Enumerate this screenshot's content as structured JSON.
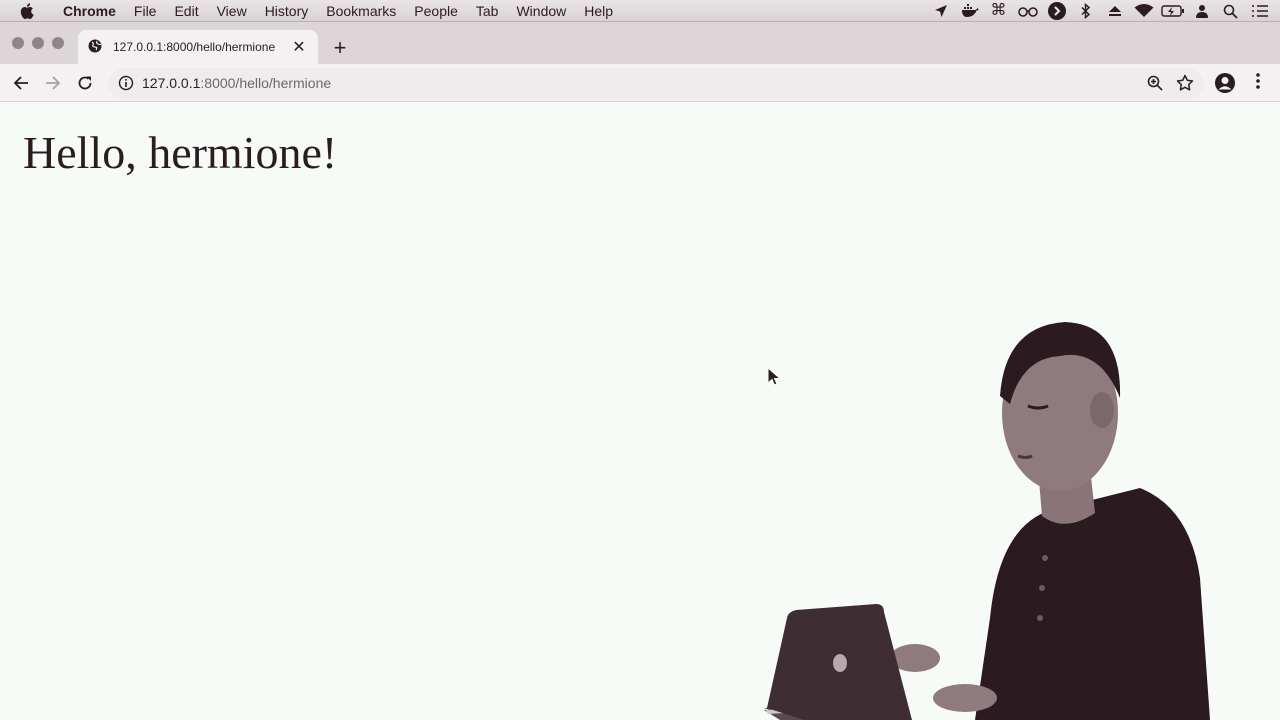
{
  "menubar": {
    "app": "Chrome",
    "items": [
      "File",
      "Edit",
      "View",
      "History",
      "Bookmarks",
      "People",
      "Tab",
      "Window",
      "Help"
    ],
    "status_icons": [
      "location-arrow-icon",
      "docker-icon",
      "command-icon",
      "glasses-icon",
      "chevron-circle-icon",
      "bluetooth-icon",
      "eject-icon",
      "wifi-icon",
      "battery-charging-icon",
      "user-icon",
      "spotlight-search-icon",
      "notification-list-icon"
    ]
  },
  "tab": {
    "title": "127.0.0.1:8000/hello/hermione",
    "close": "✕"
  },
  "newtab": "+",
  "omnibox": {
    "host": "127.0.0.1",
    "path": ":8000/hello/hermione"
  },
  "page": {
    "heading": "Hello, hermione!"
  },
  "colors": {
    "page_background": "#f7fbf8",
    "text": "#2b1c20",
    "chrome_frame": "#dcd6d9",
    "toolbar": "#f3f1f2"
  }
}
